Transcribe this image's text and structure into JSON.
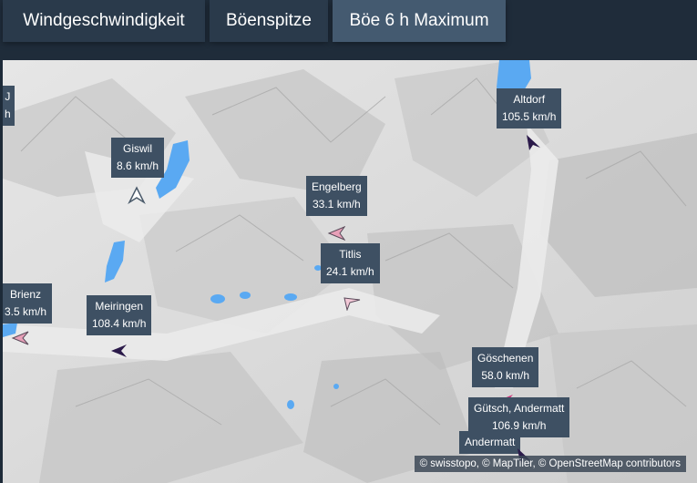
{
  "tabs": [
    {
      "label": "Windgeschwindigkeit",
      "active": false
    },
    {
      "label": "Böenspitze",
      "active": false
    },
    {
      "label": "Böe 6 h Maximum",
      "active": true
    }
  ],
  "stations": [
    {
      "name": "J",
      "value": "h"
    },
    {
      "name": "Altdorf",
      "value": "105.5 km/h"
    },
    {
      "name": "Giswil",
      "value": "8.6 km/h"
    },
    {
      "name": "Engelberg",
      "value": "33.1 km/h"
    },
    {
      "name": "Titlis",
      "value": "24.1 km/h"
    },
    {
      "name": "Brienz",
      "value": "3.5 km/h"
    },
    {
      "name": "Meiringen",
      "value": "108.4 km/h"
    },
    {
      "name": "Göschenen",
      "value": "58.0 km/h"
    },
    {
      "name": "Gütsch, Andermatt",
      "value": "106.9 km/h"
    },
    {
      "name": "Andermatt",
      "value": ""
    }
  ],
  "colors": {
    "tab_bg": "#2a3a4b",
    "tab_active_bg": "#445a70",
    "label_bg": "#3e5063",
    "water": "#5aa9f2",
    "arrow_dark": "#2b1a4a",
    "arrow_pink": "#e8a0b8",
    "arrow_magenta": "#d0307a"
  },
  "attribution": "© swisstopo, © MapTiler, © OpenStreetMap contributors"
}
